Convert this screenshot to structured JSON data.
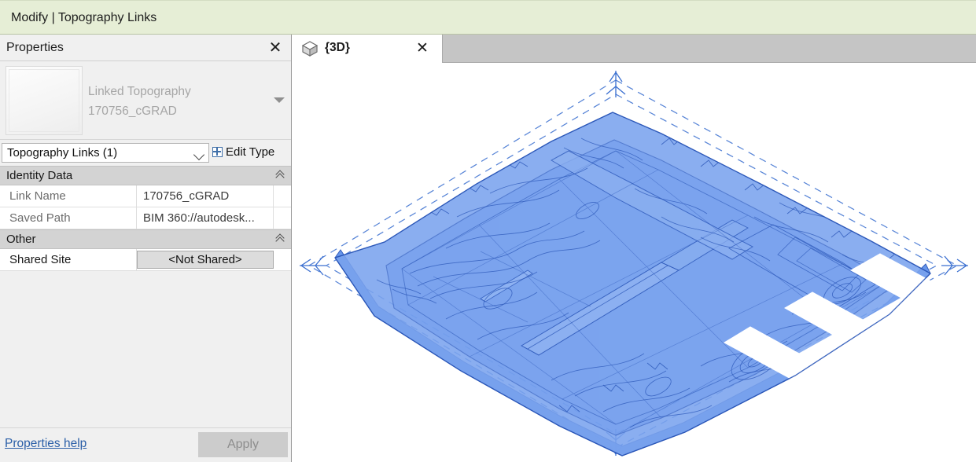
{
  "ribbon": {
    "context_tab_label": "Modify | Topography Links",
    "background_color": "#e6eed6"
  },
  "properties_palette": {
    "title": "Properties",
    "close_icon": "close-icon",
    "type_preview": {
      "family_label": "Linked Topography",
      "type_label": "170756_cGRAD",
      "dropdown_icon": "chevron-down-icon"
    },
    "category_selector": {
      "value": "Topography Links (1)",
      "chevron_icon": "chevron-down-icon"
    },
    "edit_type_button": {
      "label": "Edit Type",
      "icon": "edit-type-icon"
    },
    "parameter_groups": [
      {
        "title": "Identity Data",
        "collapse_icon": "collapse-chevron-icon",
        "rows": [
          {
            "name": "Link Name",
            "value": "170756_cGRAD",
            "kind": "text"
          },
          {
            "name": "Saved Path",
            "value": "BIM 360://autodesk...",
            "kind": "text"
          }
        ]
      },
      {
        "title": "Other",
        "collapse_icon": "collapse-chevron-icon",
        "rows": [
          {
            "name": "Shared Site",
            "value": "<Not Shared>",
            "kind": "button"
          }
        ]
      }
    ],
    "footer": {
      "help_link": "Properties help",
      "apply_button": "Apply",
      "apply_enabled": false
    }
  },
  "view_area": {
    "tabs": [
      {
        "label": "{3D}",
        "icon": "home-3d-view-icon",
        "close_icon": "close-icon",
        "active": true
      }
    ],
    "canvas": {
      "name": "3d-model-canvas",
      "background_color": "#ffffff",
      "selection_fill": "#6f9ced",
      "selection_edge": "#2a56b8",
      "selection_box_color": "#3a6fd0",
      "building_cutout_color": "#ffffff",
      "selected_element": "Linked Topography 170756_cGRAD"
    }
  }
}
